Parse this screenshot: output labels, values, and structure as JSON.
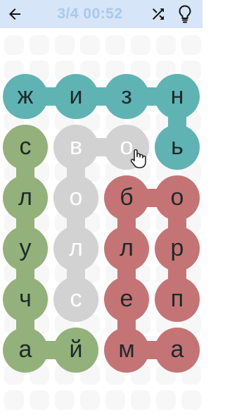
{
  "header": {
    "back_icon": "arrow-left-icon",
    "progress": "3/4 00:52",
    "shuffle_icon": "shuffle-icon",
    "hint_icon": "lightbulb-icon",
    "bar_color": "#d6e5f7",
    "progress_color": "#a9c9ec"
  },
  "colors": {
    "teal": "#5fb3b3",
    "green": "#93b17a",
    "red": "#c57475",
    "selected": "#d2d2d2",
    "text_dark": "#1e2a2a",
    "text_light": "#ffffff"
  },
  "board": {
    "rows": 6,
    "cols": 4,
    "cells": [
      [
        "ж",
        "и",
        "з",
        "н"
      ],
      [
        "с",
        "в",
        "о",
        "ь"
      ],
      [
        "л",
        "о",
        "б",
        "о"
      ],
      [
        "у",
        "л",
        "л",
        "р"
      ],
      [
        "ч",
        "с",
        "е",
        "п"
      ],
      [
        "а",
        "й",
        "м",
        "а"
      ]
    ],
    "groups": [
      {
        "name": "teal",
        "state": "found",
        "path": [
          [
            0,
            0
          ],
          [
            0,
            1
          ],
          [
            0,
            2
          ],
          [
            0,
            3
          ],
          [
            1,
            3
          ]
        ]
      },
      {
        "name": "green",
        "state": "found",
        "path": [
          [
            1,
            0
          ],
          [
            2,
            0
          ],
          [
            3,
            0
          ],
          [
            4,
            0
          ],
          [
            5,
            0
          ],
          [
            5,
            1
          ]
        ]
      },
      {
        "name": "selected",
        "state": "selecting",
        "path": [
          [
            1,
            2
          ],
          [
            1,
            1
          ],
          [
            2,
            1
          ],
          [
            3,
            1
          ],
          [
            4,
            1
          ]
        ]
      },
      {
        "name": "red",
        "state": "found",
        "path": [
          [
            5,
            3
          ],
          [
            5,
            2
          ],
          [
            4,
            2
          ],
          [
            3,
            2
          ],
          [
            2,
            2
          ],
          [
            2,
            3
          ],
          [
            3,
            3
          ],
          [
            4,
            3
          ]
        ]
      }
    ]
  },
  "pointer_icon": "hand-pointer-icon"
}
